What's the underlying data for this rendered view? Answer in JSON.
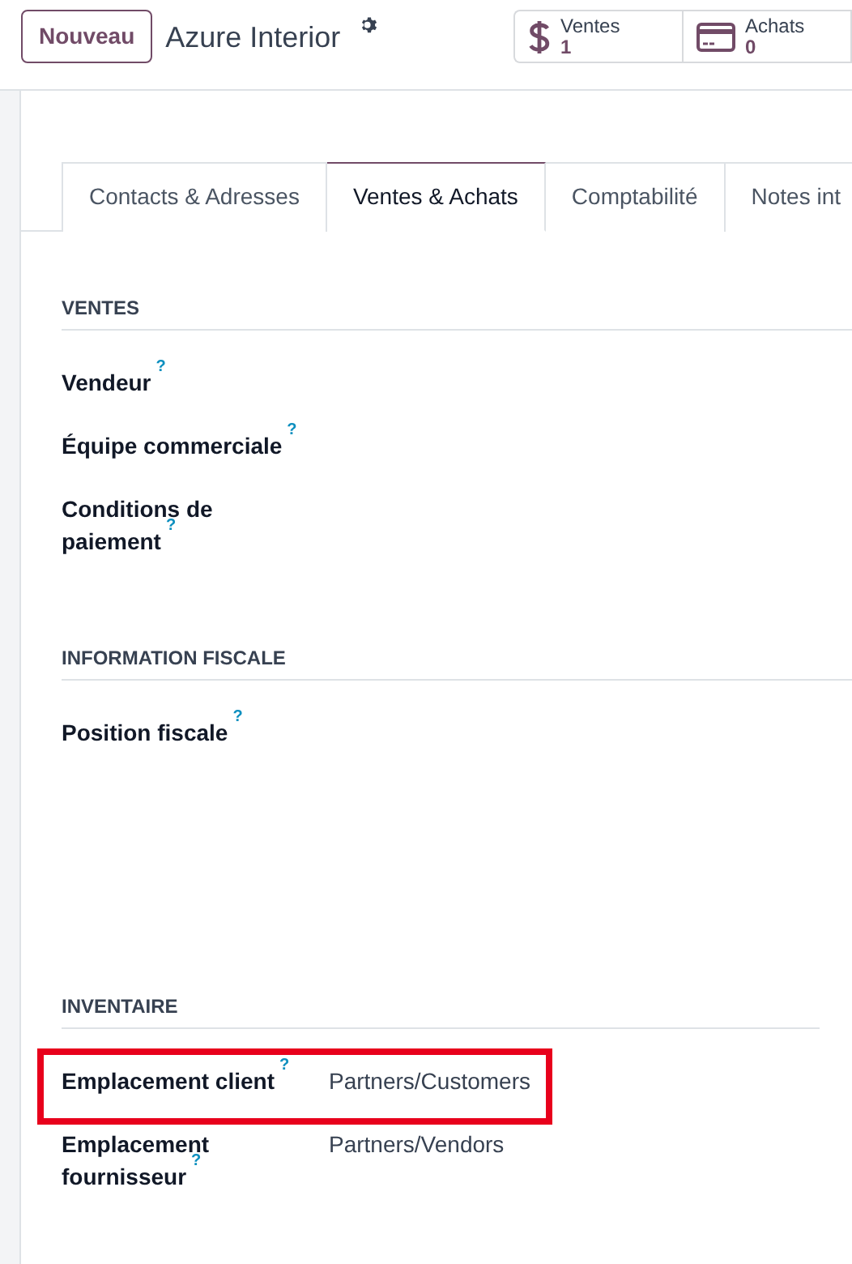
{
  "header": {
    "new_button": "Nouveau",
    "record_title": "Azure Interior",
    "stat_buttons": [
      {
        "kind": "dollar",
        "label": "Ventes",
        "count": "1"
      },
      {
        "kind": "card",
        "label": "Achats",
        "count": "0"
      }
    ]
  },
  "tabs": [
    {
      "label": "Contacts & Adresses",
      "selected": false
    },
    {
      "label": "Ventes & Achats",
      "selected": true
    },
    {
      "label": "Comptabilité",
      "selected": false
    },
    {
      "label": "Notes int",
      "selected": false
    }
  ],
  "sections": [
    {
      "title": "VENTES",
      "fields": [
        {
          "label": "Vendeur",
          "help": "?",
          "highlighted": false
        },
        {
          "label": "Équipe commerciale",
          "help": "?",
          "highlighted": false
        },
        {
          "label": "Conditions de paiement",
          "help": "?",
          "highlighted": false
        }
      ]
    },
    {
      "title": "INFORMATION FISCALE",
      "fields": [
        {
          "label": "Position fiscale",
          "help": "?",
          "highlighted": false
        }
      ]
    },
    {
      "title": "INVENTAIRE",
      "fields": [
        {
          "label": "Emplacement client",
          "help": "?",
          "value": "Partners/Customers",
          "highlighted": true
        },
        {
          "label": "Emplacement fournisseur",
          "help": "?",
          "value": "Partners/Vendors",
          "highlighted": false
        }
      ]
    }
  ]
}
